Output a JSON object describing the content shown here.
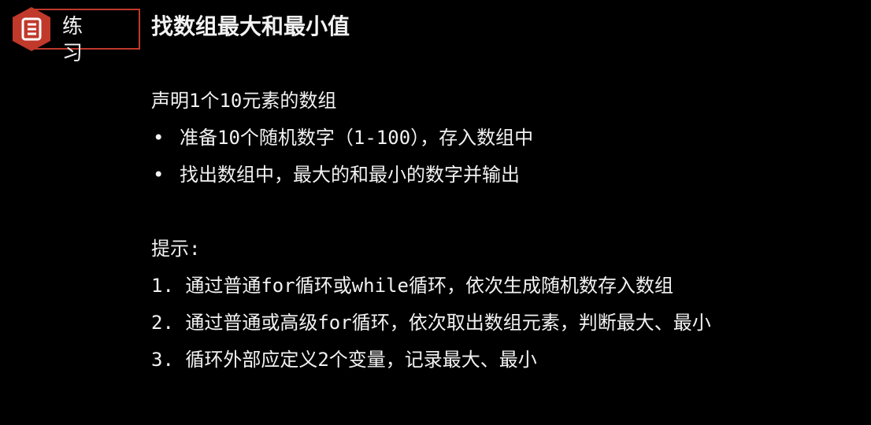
{
  "header": {
    "badge_icon": "document-icon",
    "badge_label": "练习",
    "accent_color": "#c0392b",
    "title": "找数组最大和最小值"
  },
  "task": {
    "intro": "声明1个10元素的数组",
    "bullets": [
      "准备10个随机数字（1-100），存入数组中",
      "找出数组中，最大的和最小的数字并输出"
    ],
    "bullet_glyph": "•"
  },
  "hints": {
    "heading": "提示:",
    "items": [
      "1. 通过普通for循环或while循环，依次生成随机数存入数组",
      "2. 通过普通或高级for循环，依次取出数组元素，判断最大、最小",
      "3. 循环外部应定义2个变量，记录最大、最小"
    ]
  }
}
